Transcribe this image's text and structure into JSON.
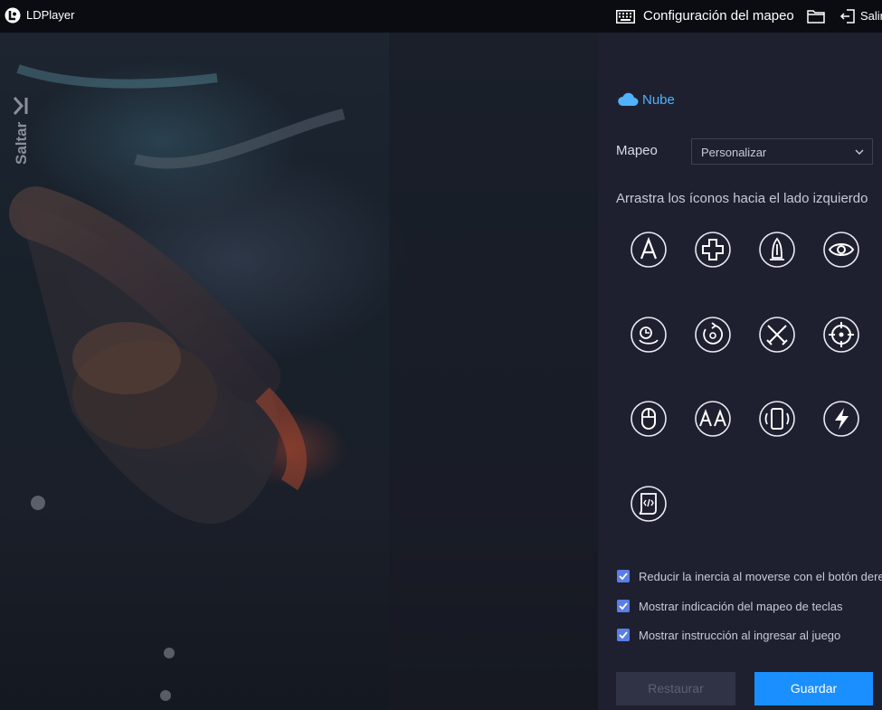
{
  "titlebar": {
    "app_name": "LDPlayer",
    "title": "Configuración del mapeo",
    "exit_label": "Salir",
    "icons": [
      "ldplayer-logo-icon",
      "keyboard-icon",
      "folder-icon",
      "exit-icon"
    ]
  },
  "game": {
    "skip_label": "Saltar"
  },
  "panel": {
    "cloud_label": "Nube",
    "mapping_label": "Mapeo",
    "mapping_value": "Personalizar",
    "drag_hint": "Arrastra los íconos hacia el lado izquierdo",
    "key_icons": [
      "tap-key-icon",
      "dpad-icon",
      "skill-icon",
      "view-icon",
      "joystick-icon",
      "rotate-view-icon",
      "attack-icon",
      "crosshair-icon",
      "mouse-icon",
      "combo-keys-icon",
      "gravity-sensor-icon",
      "macro-flash-icon",
      "script-icon"
    ],
    "options": [
      {
        "label": "Reducir la inercia al moverse con el botón derecho",
        "checked": true
      },
      {
        "label": "Mostrar indicación del mapeo de teclas",
        "checked": true
      },
      {
        "label": "Mostrar instrucción al ingresar al juego",
        "checked": true
      }
    ],
    "restore_label": "Restaurar",
    "save_label": "Guardar"
  },
  "colors": {
    "accent": "#1a8fff",
    "cloud": "#4fb3ff",
    "checkbox": "#5a7ee6",
    "panel_bg": "#1e2030",
    "titlebar_bg": "#0b0c12"
  }
}
